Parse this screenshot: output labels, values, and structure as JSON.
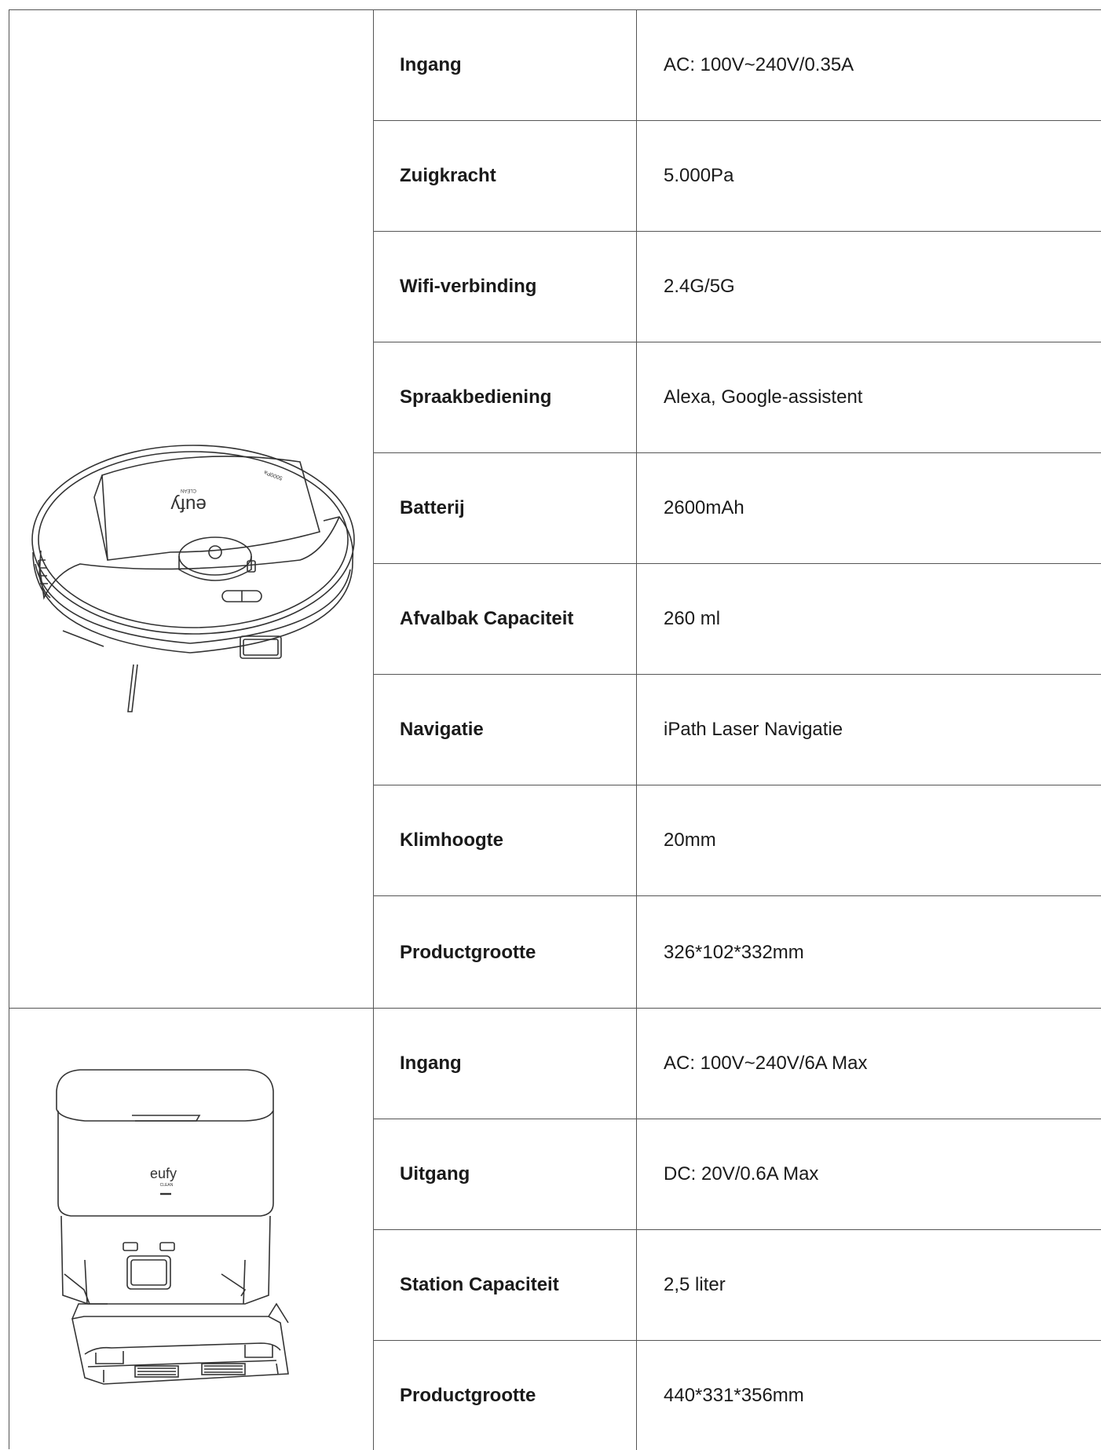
{
  "robot": {
    "specs": [
      {
        "label": "Ingang",
        "value": "AC: 100V~240V/0.35A"
      },
      {
        "label": "Zuigkracht",
        "value": "5.000Pa"
      },
      {
        "label": "Wifi-verbinding",
        "value": "2.4G/5G"
      },
      {
        "label": "Spraakbediening",
        "value": "Alexa, Google-assistent"
      },
      {
        "label": "Batterij",
        "value": "2600mAh"
      },
      {
        "label": "Afvalbak Capaciteit",
        "value": "260 ml"
      },
      {
        "label": "Navigatie",
        "value": "iPath Laser Navigatie"
      },
      {
        "label": "Klimhoogte",
        "value": "20mm"
      },
      {
        "label": "Productgrootte",
        "value": "326*102*332mm"
      }
    ],
    "logo_text": "eufy",
    "logo_sub": "CLEAN",
    "lid_text": "5000Pa"
  },
  "station": {
    "specs": [
      {
        "label": "Ingang",
        "value": "AC: 100V~240V/6A Max"
      },
      {
        "label": "Uitgang",
        "value": "DC: 20V/0.6A Max"
      },
      {
        "label": "Station Capaciteit",
        "value": "2,5 liter"
      },
      {
        "label": "Productgrootte",
        "value": "440*331*356mm"
      }
    ],
    "logo_text": "eufy",
    "logo_sub": "CLEAN"
  }
}
